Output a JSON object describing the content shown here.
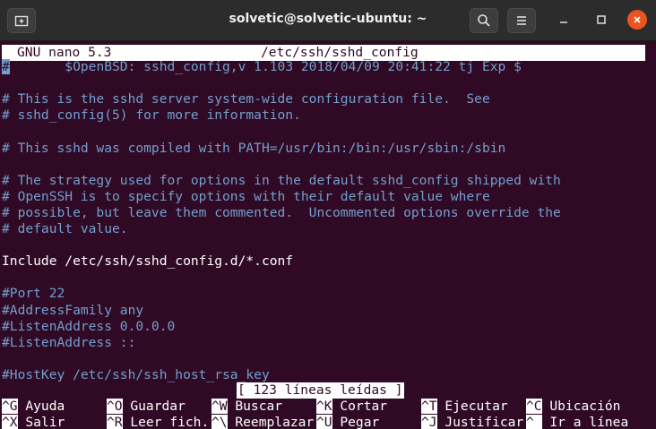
{
  "window": {
    "title": "solvetic@solvetic-ubuntu: ~",
    "icons": {
      "new_tab": "new-tab-icon",
      "search": "search-icon",
      "menu": "hamburger-menu-icon",
      "minimize": "minimize-icon",
      "maximize": "maximize-icon",
      "close": "close-icon"
    }
  },
  "nano": {
    "version": "GNU nano 5.3",
    "filename": "/etc/ssh/sshd_config",
    "cursor_char": "#",
    "lines": [
      {
        "text": "       $OpenBSD: sshd_config,v 1.103 2018/04/09 20:41:22 tj Exp $",
        "type": "comment"
      },
      {
        "text": "",
        "type": "plain"
      },
      {
        "text": "# This is the sshd server system-wide configuration file.  See",
        "type": "comment"
      },
      {
        "text": "# sshd_config(5) for more information.",
        "type": "comment"
      },
      {
        "text": "",
        "type": "plain"
      },
      {
        "text": "# This sshd was compiled with PATH=/usr/bin:/bin:/usr/sbin:/sbin",
        "type": "comment"
      },
      {
        "text": "",
        "type": "plain"
      },
      {
        "text": "# The strategy used for options in the default sshd_config shipped with",
        "type": "comment"
      },
      {
        "text": "# OpenSSH is to specify options with their default value where",
        "type": "comment"
      },
      {
        "text": "# possible, but leave them commented.  Uncommented options override the",
        "type": "comment"
      },
      {
        "text": "# default value.",
        "type": "comment"
      },
      {
        "text": "",
        "type": "plain"
      },
      {
        "text": "Include /etc/ssh/sshd_config.d/*.conf",
        "type": "plain"
      },
      {
        "text": "",
        "type": "plain"
      },
      {
        "text": "#Port 22",
        "type": "comment"
      },
      {
        "text": "#AddressFamily any",
        "type": "comment"
      },
      {
        "text": "#ListenAddress 0.0.0.0",
        "type": "comment"
      },
      {
        "text": "#ListenAddress ::",
        "type": "comment"
      },
      {
        "text": "",
        "type": "plain"
      },
      {
        "text": "#HostKey /etc/ssh/ssh_host_rsa_key",
        "type": "comment"
      }
    ],
    "status": "[ 123 líneas leídas ]",
    "shortcuts_row1": [
      {
        "key": "^G",
        "label": "Ayuda"
      },
      {
        "key": "^O",
        "label": "Guardar"
      },
      {
        "key": "^W",
        "label": "Buscar"
      },
      {
        "key": "^K",
        "label": "Cortar"
      },
      {
        "key": "^T",
        "label": "Ejecutar"
      },
      {
        "key": "^C",
        "label": "Ubicación"
      }
    ],
    "shortcuts_row2": [
      {
        "key": "^X",
        "label": "Salir"
      },
      {
        "key": "^R",
        "label": "Leer fich."
      },
      {
        "key": "^\\",
        "label": "Reemplazar"
      },
      {
        "key": "^U",
        "label": "Pegar"
      },
      {
        "key": "^J",
        "label": "Justificar"
      },
      {
        "key": "^_",
        "label": "Ir a línea"
      }
    ]
  }
}
